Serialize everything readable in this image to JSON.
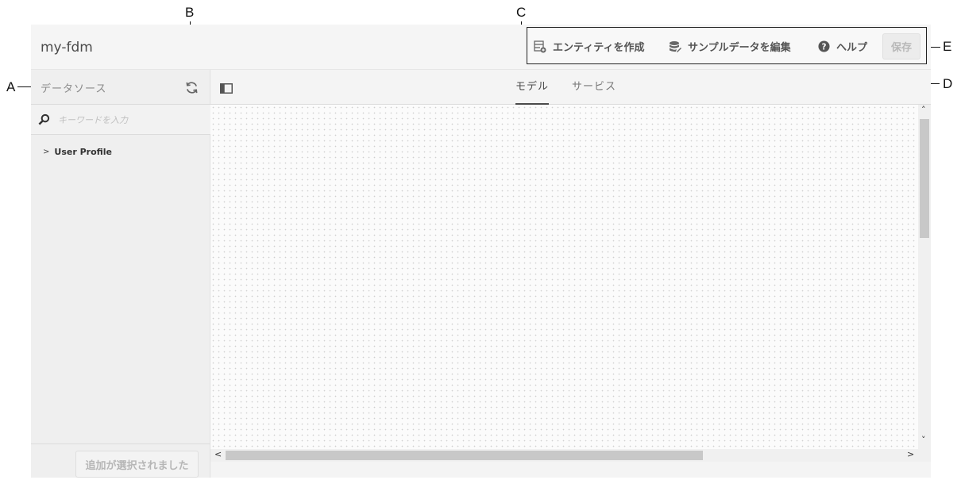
{
  "callouts": {
    "a": "A",
    "b": "B",
    "c": "C",
    "d": "D",
    "e": "E"
  },
  "app": {
    "title": "my-fdm"
  },
  "toolbar": {
    "create_entity": "エンティティを作成",
    "edit_sample_data": "サンプルデータを編集",
    "help": "ヘルプ",
    "save": "保存"
  },
  "sidebar": {
    "title": "データソース",
    "search_placeholder": "キーワードを入力",
    "items": [
      {
        "label": "User Profile"
      }
    ],
    "add_selected": "追加が選択されました"
  },
  "tabs": [
    {
      "label": "モデル",
      "active": true
    },
    {
      "label": "サービス",
      "active": false
    }
  ],
  "colors": {
    "accent": "#4b4b4b",
    "background": "#f4f4f4"
  }
}
